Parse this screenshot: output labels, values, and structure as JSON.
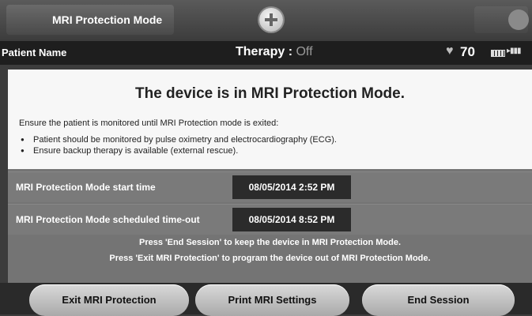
{
  "header": {
    "title": "MRI Protection Mode",
    "home_icon": "plus-circle-icon",
    "right_icon": "circle-icon"
  },
  "status": {
    "patient": "Patient Name",
    "therapy_label": "Therapy :",
    "therapy_value": "Off",
    "heart_rate": "70",
    "heart_icon": "heart-icon"
  },
  "main": {
    "headline": "The device is in MRI Protection Mode.",
    "instruction": "Ensure the patient is monitored until MRI Protection mode is exited:",
    "bullets": [
      "Patient should be monitored by pulse oximetry and electrocardiography (ECG).",
      "Ensure backup therapy is available (external rescue)."
    ],
    "start_label": "MRI Protection Mode start time",
    "start_value": "08/05/2014 2:52 PM",
    "timeout_label": "MRI Protection Mode scheduled time-out",
    "timeout_value": "08/05/2014 8:52 PM",
    "note1": "Press 'End Session' to keep the device in MRI Protection Mode.",
    "note2": "Press 'Exit MRI Protection' to program the device out of MRI Protection Mode."
  },
  "footer": {
    "exit_label": "Exit MRI Protection",
    "print_label": "Print MRI Settings",
    "end_label": "End Session"
  }
}
